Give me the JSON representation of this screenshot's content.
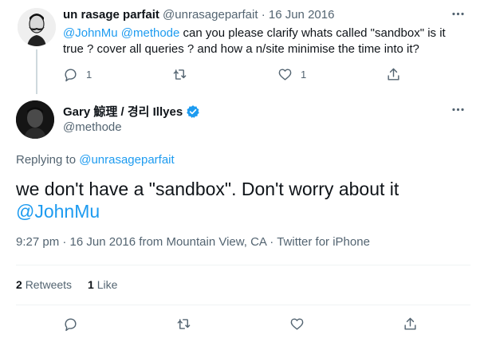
{
  "parent_tweet": {
    "display_name": "un rasage parfait",
    "handle": "@unrasageparfait",
    "separator": "·",
    "date": "16 Jun 2016",
    "mention_1": "@JohnMu",
    "mention_2": "@methode",
    "text": " can you please clarify whats called \"sandbox\" is it true ? cover all queries ? and how a n/site minimise the time into it?",
    "reply_count": "1",
    "retweet_count": "",
    "like_count": "1"
  },
  "main_tweet": {
    "display_name": "Gary 鯨理 / 경리 Illyes",
    "handle": "@methode",
    "replying_label": "Replying to",
    "replying_handle": "@unrasageparfait",
    "text": "we don't have a \"sandbox\". Don't worry about it",
    "mention": "@JohnMu",
    "time": "9:27 pm",
    "separator": "·",
    "date": "16 Jun 2016",
    "location": "from Mountain View, CA",
    "source": "Twitter for iPhone",
    "retweets_count": "2",
    "retweets_label": "Retweets",
    "likes_count": "1",
    "likes_label": "Like"
  },
  "colors": {
    "link": "#1d9bf0",
    "muted": "#536471",
    "text": "#0f1419",
    "verified": "#1d9bf0"
  },
  "icons": [
    "more-icon",
    "reply-icon",
    "retweet-icon",
    "like-icon",
    "share-icon",
    "verified-badge-icon"
  ]
}
